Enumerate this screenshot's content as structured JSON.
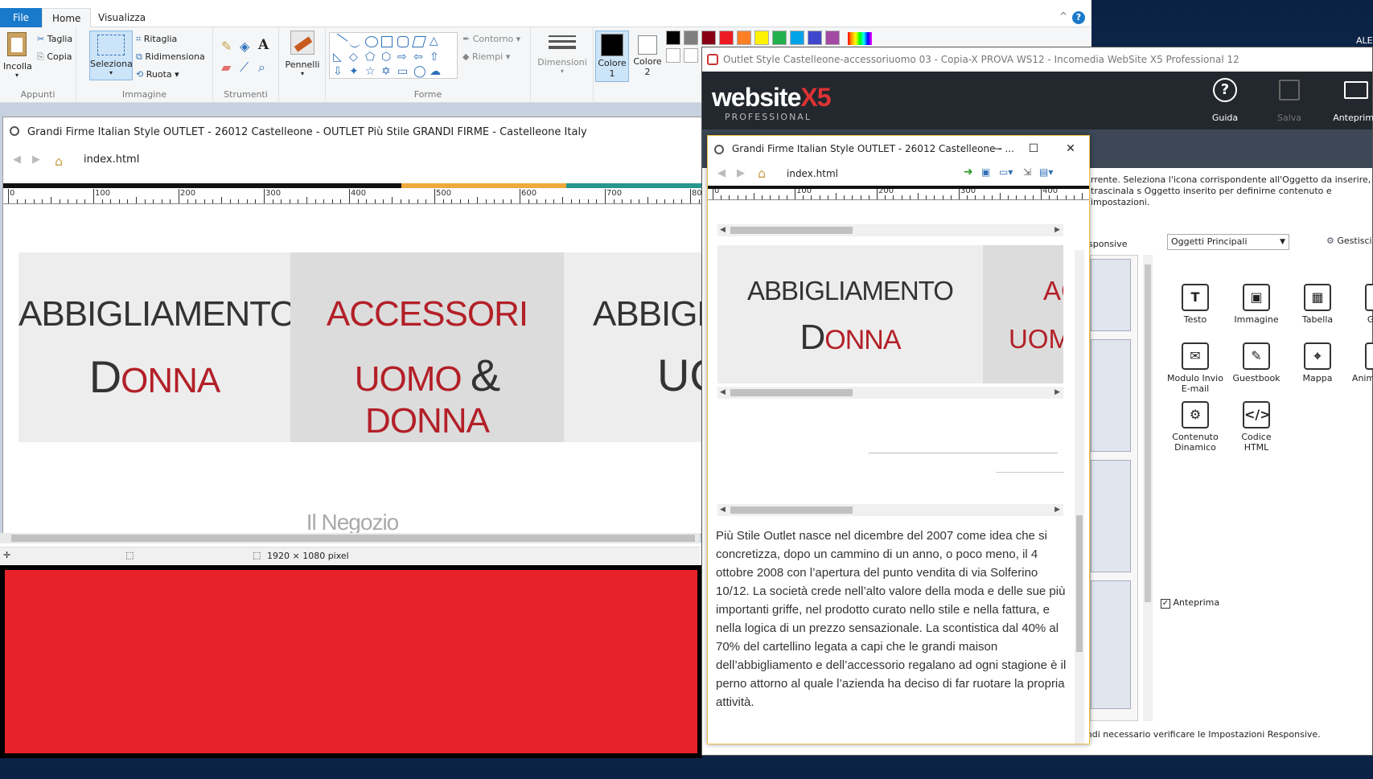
{
  "desktop": {
    "user_label": "ALE"
  },
  "paint": {
    "tabs": [
      {
        "label": "File"
      },
      {
        "label": "Home"
      },
      {
        "label": "Visualizza"
      }
    ],
    "help_label": "?",
    "collapse_label": "^",
    "clipboard": {
      "paste": "Incolla",
      "cut": "Taglia",
      "copy": "Copia",
      "group": "Appunti"
    },
    "image": {
      "select": "Seleziona",
      "crop": "Ritaglia",
      "resize": "Ridimensiona",
      "rotate": "Ruota",
      "group": "Immagine"
    },
    "tools": {
      "group": "Strumenti",
      "text_tool": "A"
    },
    "brushes": {
      "label": "Pennelli"
    },
    "shapes": {
      "outline": "Contorno",
      "fill": "Riempi",
      "group": "Forme"
    },
    "size": {
      "label": "Dimensioni"
    },
    "color1": {
      "label": "Colore",
      "num": "1"
    },
    "color2": {
      "label": "Colore",
      "num": "2"
    },
    "palette": [
      "#000000",
      "#7f7f7f",
      "#880015",
      "#ed1c24",
      "#ff7f27",
      "#fff200",
      "#22b14c",
      "#00a2e8",
      "#3f48cc",
      "#a349a4"
    ],
    "status": {
      "size": "1920 × 1080 pixel"
    },
    "red_fill": "#e8222a"
  },
  "paint_browser": {
    "title": "Grandi Firme Italian Style OUTLET - 26012 Castelleone - OUTLET Più Stile GRANDI FIRME - Castelleone Italy",
    "url": "index.html",
    "ruler": [
      "0",
      "100",
      "200",
      "300",
      "400",
      "500",
      "600",
      "700",
      "800"
    ],
    "card1": {
      "line1": "ABBIGLIAMENTO",
      "cap": "D",
      "rest": "ONNA"
    },
    "card2": {
      "line1": "ACCESSORI",
      "l2a": "UOMO",
      "amp": "&",
      "l2b": "DONNA"
    },
    "card3": {
      "line1": "ABBIGLIA",
      "line2": "UO"
    },
    "shop_title": "Il Negozio"
  },
  "x5": {
    "title": "Outlet Style Castelleone-accessoriuomo 03 - Copia-X PROVA WS12 - Incomedia WebSite X5 Professional 12",
    "logo_main": "website",
    "logo_x5": "X5",
    "logo_sub": "PROFESSIONAL",
    "buttons": {
      "guide": "Guida",
      "save": "Salva",
      "preview": "Anteprima"
    },
    "desc": "rrente. Seleziona l'icona corrispondente all'Oggetto da inserire, trascinala s Oggetto inserito per definirne contenuto e impostazioni.",
    "responsive_label": "sponsive",
    "objects_select": "Oggetti Principali",
    "manage": "Gestisci",
    "objects": [
      {
        "label": "Testo",
        "glyph": "T"
      },
      {
        "label": "Immagine",
        "glyph": "▣"
      },
      {
        "label": "Tabella",
        "glyph": "▦"
      },
      {
        "label": "Galle",
        "glyph": "▤"
      },
      {
        "label": "Modulo Invio E-mail",
        "glyph": "✉"
      },
      {
        "label": "Guestbook",
        "glyph": "✎"
      },
      {
        "label": "Mappa",
        "glyph": "⌖"
      },
      {
        "label": "Animaz Flas",
        "glyph": "▶"
      },
      {
        "label": "Contenuto Dinamico",
        "glyph": "⚙"
      },
      {
        "label": "Codice HTML",
        "glyph": "</>"
      }
    ],
    "preview_check": "Anteprima",
    "footer": "La struttura della Pagina è stata modificata ed è quindi necessario verificare le Impostazioni Responsive."
  },
  "preview": {
    "title": "Grandi Firme Italian Style OUTLET - 26012 Castelleone - ...",
    "url": "index.html",
    "ruler": [
      "0",
      "100",
      "200",
      "300",
      "400"
    ],
    "card1": {
      "line1": "ABBIGLIAMENTO",
      "cap": "D",
      "rest": "ONNA"
    },
    "card2": {
      "line1": "AC",
      "line2": "UOMO"
    },
    "body_text": "Più Stile Outlet nasce nel dicembre del 2007 come idea che si concretizza, dopo un cammino di un anno, o poco meno, il 4 ottobre 2008 con l’apertura del punto vendita di via Solferino 10/12. La società crede nell’alto valore della moda e delle sue più importanti griffe, nel prodotto curato nello stile e nella fattura, e nella logica di un prezzo sensazionale. La scontistica dal 40% al 70% del cartellino legata a capi che le grandi maison dell’abbigliamento e dell’accessorio regalano ad ogni stagione è il perno attorno al quale l’azienda ha deciso di far ruotare la propria attività."
  }
}
